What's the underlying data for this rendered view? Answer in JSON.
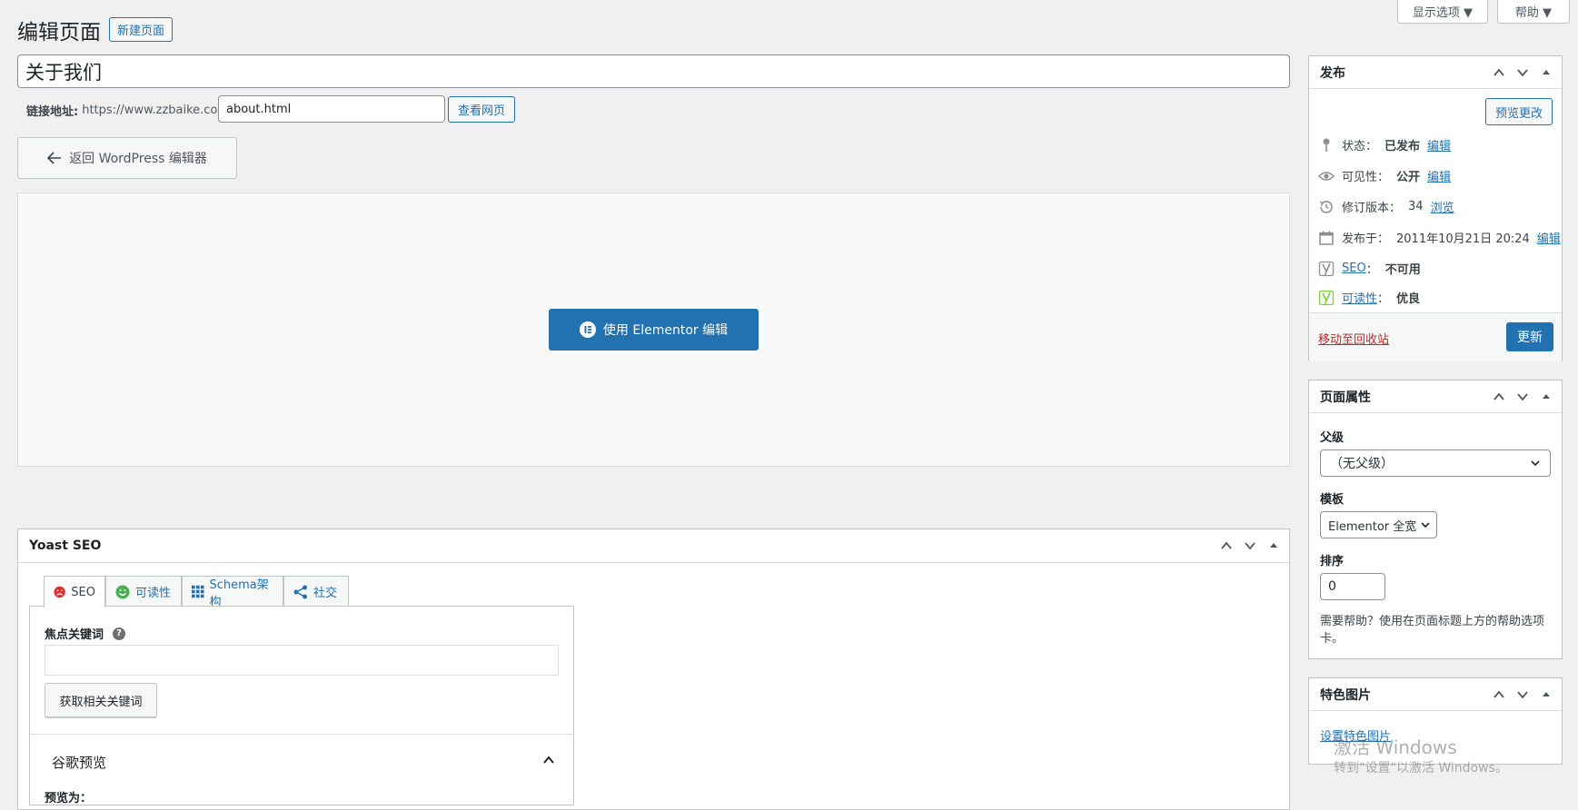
{
  "screen_options": {
    "label": "显示选项 ▼"
  },
  "help": {
    "label": "帮助 ▼"
  },
  "header": {
    "title": "编辑页面",
    "new_page_button": "新建页面"
  },
  "title_input": {
    "value": "关于我们"
  },
  "permalink": {
    "label": "链接地址:",
    "base": "https://www.zzbaike.com/",
    "slug": "about.html",
    "view_button": "查看网页"
  },
  "back_button": {
    "label": "返回 WordPress 编辑器"
  },
  "elementor_button": {
    "label": "使用 Elementor 编辑"
  },
  "publish": {
    "title": "发布",
    "preview_button": "预览更改",
    "status_label": "状态：",
    "status_value": "已发布",
    "status_edit": "编辑",
    "visibility_label": "可见性：",
    "visibility_value": "公开",
    "visibility_edit": "编辑",
    "revisions_label": "修订版本：",
    "revisions_value": "34",
    "revisions_browse": "浏览",
    "published_label": "发布于：",
    "published_value": "2011年10月21日 20:24",
    "published_edit": "编辑",
    "seo_link": "SEO",
    "seo_sep": "：",
    "seo_value": "不可用",
    "readability_link": "可读性",
    "readability_sep": "：",
    "readability_value": "优良",
    "trash_link": "移动至回收站",
    "update_button": "更新"
  },
  "page_attributes": {
    "title": "页面属性",
    "parent_label": "父级",
    "parent_value": "（无父级）",
    "template_label": "模板",
    "template_value": "Elementor 全宽",
    "order_label": "排序",
    "order_value": "0",
    "help_text": "需要帮助？使用在页面标题上方的帮助选项卡。"
  },
  "featured_image": {
    "title": "特色图片",
    "set_link": "设置特色图片"
  },
  "yoast": {
    "title": "Yoast SEO",
    "tabs": [
      "SEO",
      "可读性",
      "Schema架构",
      "社交"
    ],
    "focus_keyword_label": "焦点关键词",
    "focus_keyword_value": "",
    "related_button": "获取相关关键词",
    "google_preview": "谷歌预览",
    "preview_as": "预览为："
  },
  "watermark": {
    "line1": "激活 Windows",
    "line2": "转到\"设置\"以激活 Windows。"
  },
  "colors": {
    "primary": "#2271b1",
    "background": "#f0f0f1",
    "danger": "#b32d2e",
    "seo_bad": "#dc3232",
    "seo_good": "#7ad03a"
  }
}
